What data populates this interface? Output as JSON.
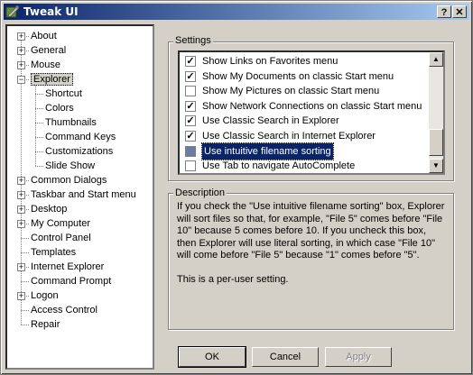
{
  "window": {
    "title": "Tweak UI",
    "help_label": "?",
    "close_label": "✕"
  },
  "tree": {
    "items": [
      {
        "label": "About",
        "level": 0,
        "expandable": true
      },
      {
        "label": "General",
        "level": 0,
        "expandable": true
      },
      {
        "label": "Mouse",
        "level": 0,
        "expandable": true
      },
      {
        "label": "Explorer",
        "level": 0,
        "expandable": true,
        "expanded": true,
        "selected": true
      },
      {
        "label": "Shortcut",
        "level": 1
      },
      {
        "label": "Colors",
        "level": 1
      },
      {
        "label": "Thumbnails",
        "level": 1
      },
      {
        "label": "Command Keys",
        "level": 1
      },
      {
        "label": "Customizations",
        "level": 1
      },
      {
        "label": "Slide Show",
        "level": 1
      },
      {
        "label": "Common Dialogs",
        "level": 0,
        "expandable": true
      },
      {
        "label": "Taskbar and Start menu",
        "level": 0,
        "expandable": true
      },
      {
        "label": "Desktop",
        "level": 0,
        "expandable": true
      },
      {
        "label": "My Computer",
        "level": 0,
        "expandable": true
      },
      {
        "label": "Control Panel",
        "level": 0
      },
      {
        "label": "Templates",
        "level": 0
      },
      {
        "label": "Internet Explorer",
        "level": 0,
        "expandable": true
      },
      {
        "label": "Command Prompt",
        "level": 0
      },
      {
        "label": "Logon",
        "level": 0,
        "expandable": true
      },
      {
        "label": "Access Control",
        "level": 0
      },
      {
        "label": "Repair",
        "level": 0
      }
    ]
  },
  "settings": {
    "label": "Settings",
    "items": [
      {
        "label": "Show Links on Favorites menu",
        "checked": true
      },
      {
        "label": "Show My Documents on classic Start menu",
        "checked": true
      },
      {
        "label": "Show My Pictures on classic Start menu",
        "checked": false
      },
      {
        "label": "Show Network Connections on classic Start menu",
        "checked": true
      },
      {
        "label": "Use Classic Search in Explorer",
        "checked": true
      },
      {
        "label": "Use Classic Search in Internet Explorer",
        "checked": true
      },
      {
        "label": "Use intuitive filename sorting",
        "checked": false,
        "selected": true
      },
      {
        "label": "Use Tab to navigate AutoComplete",
        "checked": false
      }
    ]
  },
  "description": {
    "label": "Description",
    "paragraph1": "If you check the \"Use intuitive filename sorting\" box, Explorer will sort files so that, for example, \"File 5\" comes before \"File 10\" because 5 comes before 10.  If you uncheck this box, then Explorer will use literal sorting, in which case \"File 10\" will come before \"File 5\" because \"1\" comes before \"5\".",
    "paragraph2": "This is a per-user setting."
  },
  "buttons": {
    "ok": "OK",
    "cancel": "Cancel",
    "apply": "Apply"
  }
}
